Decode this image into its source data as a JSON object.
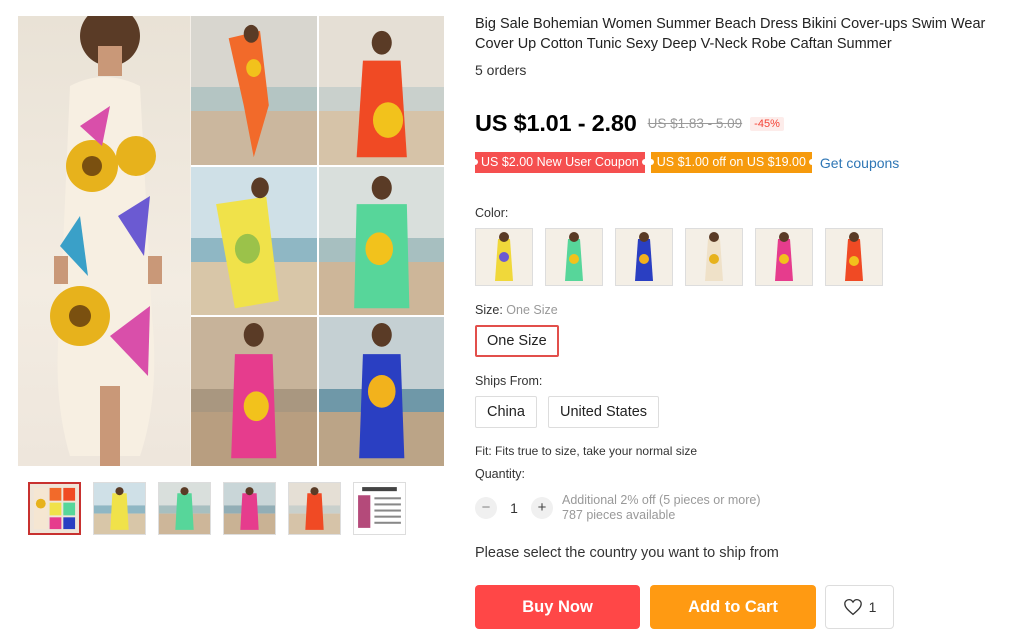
{
  "product": {
    "title": "Big Sale Bohemian Women Summer Beach Dress Bikini Cover-ups Swim Wear Cover Up Cotton Tunic Sexy Deep V-Neck Robe Caftan Summer",
    "orders": "5 orders"
  },
  "price": {
    "current": "US $1.01 - 2.80",
    "original": "US $1.83 - 5.09",
    "discount": "-45%"
  },
  "coupons": {
    "new_user": "US $2.00 New User Coupon",
    "spend": "US $1.00 off on US $19.00",
    "get_link": "Get coupons"
  },
  "color": {
    "label": "Color:",
    "options": [
      "yellow-floral",
      "green-floral",
      "blue-floral",
      "white-floral",
      "pink-floral",
      "orange-floral"
    ]
  },
  "size": {
    "label": "Size:",
    "selected": "One Size",
    "option": "One Size"
  },
  "ships_from": {
    "label": "Ships From:",
    "options": [
      "China",
      "United States"
    ]
  },
  "fit": "Fit: Fits true to size, take your normal size",
  "quantity": {
    "label": "Quantity:",
    "minus": "−",
    "value": "1",
    "plus": "+",
    "note": "Additional 2% off (5 pieces or more)",
    "available": "787 pieces available"
  },
  "ship_message": "Please select the country you want to ship from",
  "actions": {
    "buy_now": "Buy Now",
    "add_to_cart": "Add to Cart",
    "wishlist_count": "1"
  },
  "thumbnails": [
    "collage",
    "beach-orange",
    "beach-green",
    "beach-pink",
    "beach-red",
    "size-chart"
  ],
  "colors": {
    "accent_red": "#ff4747",
    "accent_orange": "#ff9a12",
    "link_blue": "#2e76b5"
  }
}
